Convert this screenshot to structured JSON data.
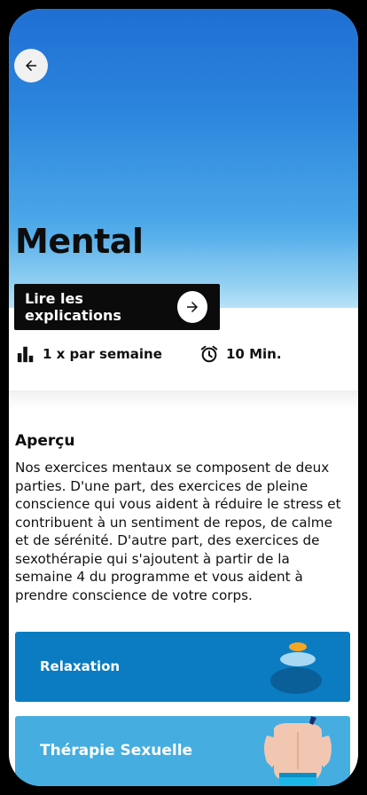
{
  "header": {
    "title": "Mental",
    "explain_button_label": "Lire les explications"
  },
  "info": {
    "frequency": "1 x par semaine",
    "duration": "10 Min."
  },
  "overview": {
    "title": "Aperçu",
    "text": "Nos exercices mentaux se composent de deux parties. D'une part, des exercices de pleine conscience qui vous aident à réduire le stress et contribuent à un sentiment de repos, de calme et de sérénité. D'autre part, des exercices de sexothérapie qui s'ajoutent à partir de la semaine 4 du programme et vous aident à prendre conscience de votre corps."
  },
  "cards": [
    {
      "label": "Relaxation",
      "color": "#0b7cc2",
      "icon": "stacked-stones-illustration"
    },
    {
      "label": "Thérapie Sexuelle",
      "color": "#45ade0",
      "icon": "person-back-illustration"
    }
  ],
  "colors": {
    "hero_top": "#1f6fd3",
    "hero_bottom": "#a6dbf4",
    "button_bg": "#0b0b0b"
  }
}
